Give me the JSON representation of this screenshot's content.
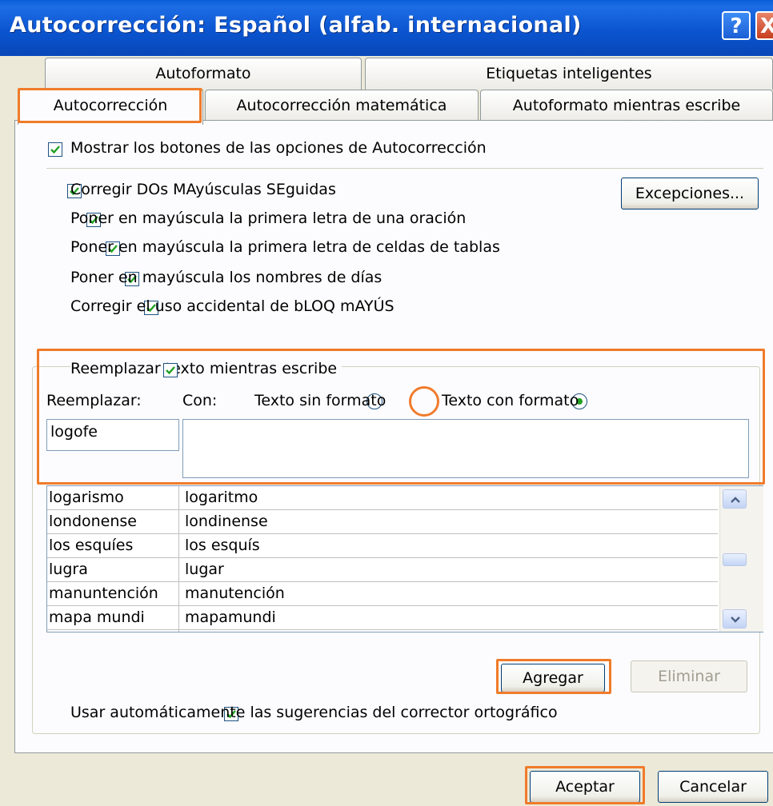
{
  "window": {
    "title": "Autocorrección: Español (alfab. internacional)",
    "help_label": "?",
    "close_label": "X"
  },
  "tabs": {
    "row1": [
      "Autoformato",
      "Etiquetas inteligentes"
    ],
    "row2": [
      "Autocorrección",
      "Autocorrección matemática",
      "Autoformato mientras escribe"
    ]
  },
  "options": {
    "show_buttons": "Mostrar los botones de las opciones de Autocorrección",
    "two_caps": "Corregir DOs MAyúsculas SEguidas",
    "cap_sentence": "Poner en mayúscula la primera letra de una oración",
    "cap_cells": "Poner en mayúscula la primera letra de celdas de tablas",
    "cap_days": "Poner en mayúscula los nombres de días",
    "caps_lock": "Corregir el uso accidental de bLOQ mAYÚS",
    "exceptions_button": "Excepciones..."
  },
  "replace": {
    "replace_as_type": "Reemplazar texto mientras escribe",
    "replace_label": "Reemplazar:",
    "with_label": "Con:",
    "plain_text": "Texto sin formato",
    "formatted_text": "Texto con formato",
    "replace_value": "logofe",
    "with_value": ""
  },
  "entries": [
    [
      "logarismo",
      "logaritmo"
    ],
    [
      "londonense",
      "londinense"
    ],
    [
      "los esquíes",
      "los esquís"
    ],
    [
      "lugra",
      "lugar"
    ],
    [
      "manuntención",
      "manutención"
    ],
    [
      "mapa mundi",
      "mapamundi"
    ]
  ],
  "buttons": {
    "add": "Agregar",
    "delete": "Eliminar",
    "ok": "Aceptar",
    "cancel": "Cancelar"
  },
  "spelling_suggestions": "Usar automáticamente las sugerencias del corrector ortográfico",
  "colors": {
    "titlebar": "#0b55d0",
    "highlight": "#f07b2a",
    "dialog_bg": "#ece9d8"
  }
}
